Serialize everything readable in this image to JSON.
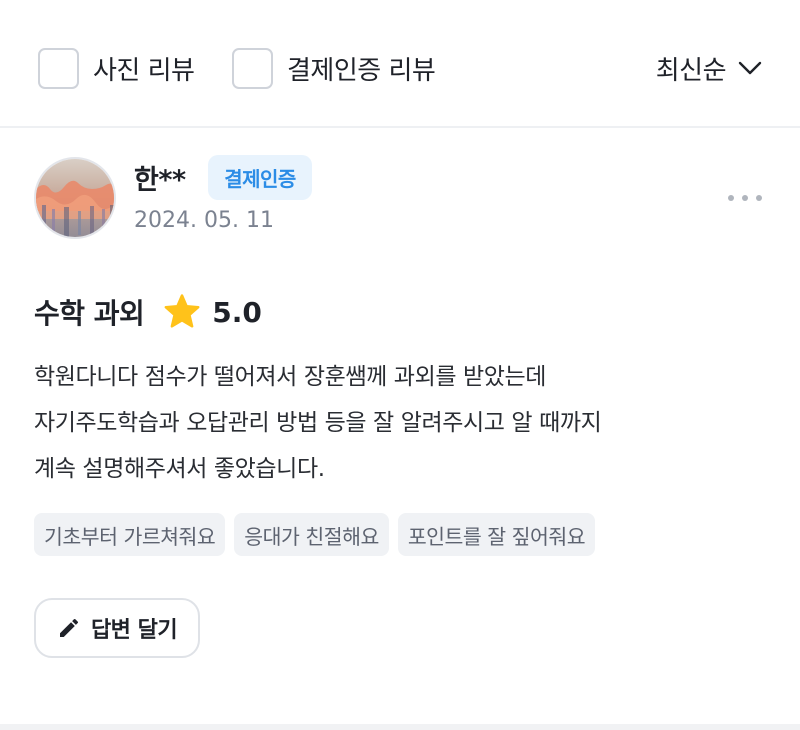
{
  "filters": {
    "photo_review": {
      "label": "사진 리뷰",
      "checked": false
    },
    "verified_review": {
      "label": "결제인증 리뷰",
      "checked": false
    }
  },
  "sort": {
    "label": "최신순",
    "icon": "chevron-down-icon"
  },
  "review": {
    "author": "한**",
    "badge": "결제인증",
    "date": "2024. 05. 11",
    "subject": "수학 과외",
    "rating": "5.0",
    "rating_icon": "star-icon",
    "body_lines": [
      "학원다니다 점수가 떨어져서 장훈쌤께 과외를 받았는데",
      "자기주도학습과 오답관리 방법 등을 잘 알려주시고 알 때까지",
      "계속 설명해주셔서 좋았습니다."
    ],
    "tags": [
      "기초부터 가르쳐줘요",
      "응대가 친절해요",
      "포인트를 잘 짚어줘요"
    ],
    "reply_button": {
      "label": "답변 달기",
      "icon": "pencil-icon"
    }
  },
  "colors": {
    "badge_bg": "#e8f3fd",
    "badge_text": "#2b8ce6",
    "star": "#ffc21a",
    "tag_bg": "#f0f2f5",
    "muted_text": "#7b8290"
  }
}
